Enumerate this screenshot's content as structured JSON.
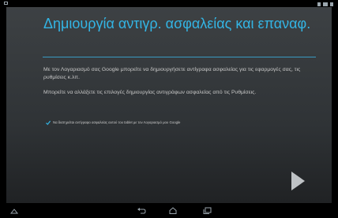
{
  "title": "Δημιουργία αντιγρ. ασφαλείας και επαναφ.",
  "paragraph1": "Με τον Λογαριασμό σας Google μπορείτε να δημιουργήσετε αντίγραφα ασφαλείας για τις εφαρμογές σας, τις ρυθμίσεις κ.λπ.",
  "paragraph2": "Μπορείτε να αλλάξετε τις επιλογές δημιουργίας αντιγράφων ασφαλείας από τις Ρυθμίσεις.",
  "checkbox": {
    "label": "Να διατηρείται αντίγραφο ασφαλείας αυτού του tablet με τον Λογαριασμό μου Google",
    "checked": true
  },
  "icons": {
    "next": "next-arrow-icon",
    "back": "back-icon",
    "home": "home-icon",
    "recents": "recent-apps-icon",
    "keyboard": "keyboard-hide-icon"
  },
  "colors": {
    "accent": "#33b5e5",
    "text": "#c8c8c8",
    "background": "#2f3336"
  }
}
